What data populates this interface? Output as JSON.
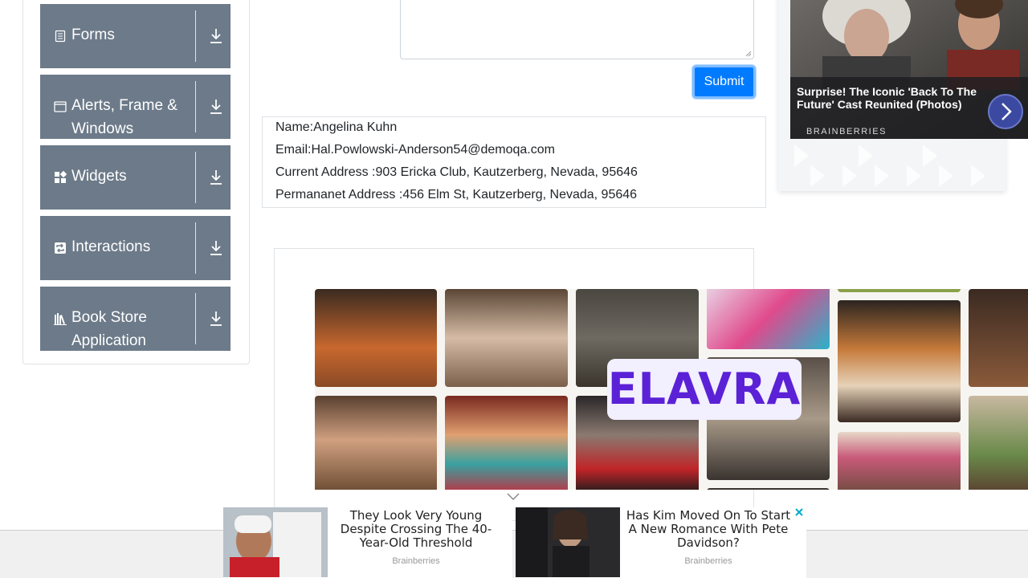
{
  "sidebar": {
    "groups": [
      {
        "label": "Forms",
        "icon": "document-icon"
      },
      {
        "label": "Alerts, Frame & Windows",
        "icon": "window-icon"
      },
      {
        "label": "Widgets",
        "icon": "widgets-icon"
      },
      {
        "label": "Interactions",
        "icon": "interactions-icon"
      },
      {
        "label": "Book Store Application",
        "icon": "books-icon"
      }
    ]
  },
  "form": {
    "submit_label": "Submit"
  },
  "output": {
    "name": "Name:Angelina Kuhn",
    "email": "Email:Hal.Powlowski-Anderson54@demoqa.com",
    "current_address": "Current Address :903 Ericka Club, Kautzerberg, Nevada, 95646",
    "permanent_address": "Permananet Address :456 Elm St, Kautzerberg, Nevada, 95646"
  },
  "right_ad": {
    "caption": "Surprise! The Iconic 'Back To The Future' Cast Reunited (Photos)",
    "brand": "BRAINBERRIES"
  },
  "elavra_ad": {
    "logo": "ELAVRA"
  },
  "bottom_ads": [
    {
      "headline": "They Look Very Young Despite Crossing The 40-Year-Old Threshold",
      "source": "Brainberries"
    },
    {
      "headline": "Has Kim Moved On To Start A New Romance With Pete Davidson?",
      "source": "Brainberries"
    }
  ],
  "colors": {
    "sidebar_group": "#6c7a89",
    "submit": "#007bff",
    "elavra": "#5b21d6"
  }
}
